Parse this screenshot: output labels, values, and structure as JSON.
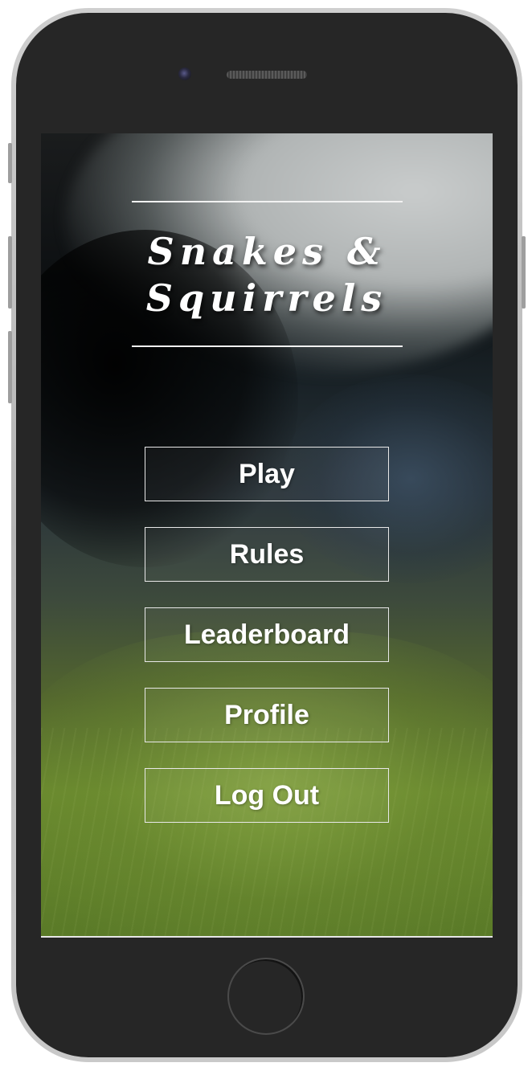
{
  "app": {
    "title_line1": "Snakes &",
    "title_line2": "Squirrels"
  },
  "menu": {
    "items": [
      {
        "label": "Play"
      },
      {
        "label": "Rules"
      },
      {
        "label": "Leaderboard"
      },
      {
        "label": "Profile"
      },
      {
        "label": "Log Out"
      }
    ]
  },
  "colors": {
    "frame": "#262626",
    "bezel": "#bdbdbd",
    "button_border": "#e8e8e8",
    "text": "#ffffff"
  }
}
